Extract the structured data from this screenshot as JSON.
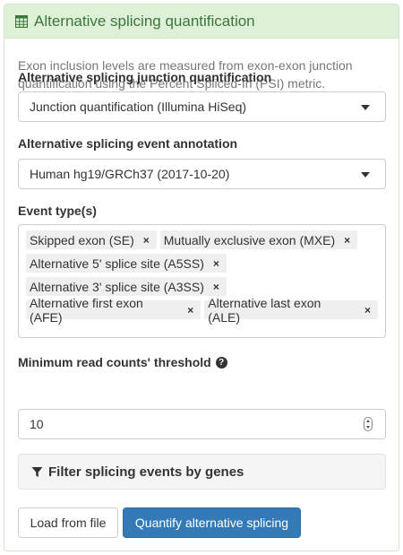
{
  "panel": {
    "title": "Alternative splicing quantification",
    "description": "Exon inclusion levels are measured from exon-exon junction quantification using the Percent Spliced-In (PSI) metric."
  },
  "junction": {
    "label": "Alternative splicing junction quantification",
    "value": "Junction quantification (Illumina HiSeq)"
  },
  "annotation": {
    "label": "Alternative splicing event annotation",
    "value": "Human hg19/GRCh37 (2017-10-20)"
  },
  "event_types": {
    "label": "Event type(s)",
    "remove_glyph": "×",
    "selected": [
      "Skipped exon (SE)",
      "Mutually exclusive exon (MXE)",
      "Alternative 5' splice site (A5SS)",
      "Alternative 3' splice site (A3SS)",
      "Alternative first exon (AFE)",
      "Alternative last exon (ALE)"
    ]
  },
  "min_reads": {
    "label": "Minimum read counts' threshold",
    "help_glyph": "?",
    "value": "10"
  },
  "gene_filter": {
    "label": "Filter splicing events by genes"
  },
  "buttons": {
    "load": "Load from file",
    "quantify": "Quantify alternative splicing"
  },
  "colors": {
    "heading_bg": "#dff0d8",
    "heading_text": "#3c763d",
    "primary": "#337ab7"
  },
  "icons": {
    "heading": "table-icon",
    "filter": "filter-icon",
    "help": "question-circle-icon"
  }
}
